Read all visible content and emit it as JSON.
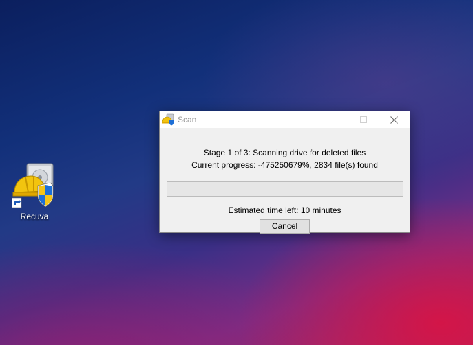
{
  "desktop": {
    "icons": [
      {
        "label": "Recuva",
        "icon": "recuva-app-icon",
        "shortcut": true
      }
    ]
  },
  "window": {
    "title": "Scan",
    "title_icon": "recuva-app-icon",
    "controls": {
      "minimize": "minimize-icon",
      "maximize": "maximize-icon",
      "close": "close-icon"
    },
    "stage_text": "Stage 1 of 3: Scanning drive for deleted files",
    "progress_text": "Current progress: -475250679%, 2834 file(s) found",
    "progress_fraction": 0,
    "time_text": "Estimated time left: 10 minutes",
    "cancel_label": "Cancel"
  },
  "colors": {
    "progress_fill": "#06b025",
    "title_text": "#999999",
    "window_bg": "#f0f0f0"
  }
}
